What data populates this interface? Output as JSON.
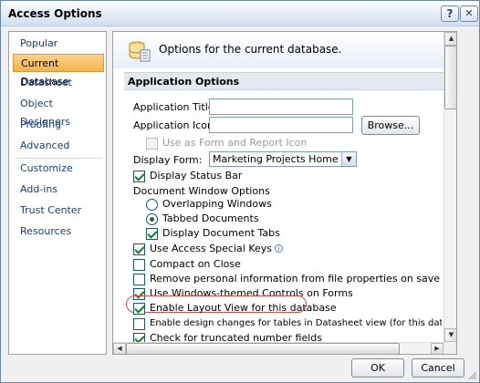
{
  "window": {
    "title": "Access Options"
  },
  "title_buttons": {
    "help": "?",
    "close": "✕"
  },
  "nav": {
    "items": [
      {
        "label": "Popular"
      },
      {
        "label": "Current Database"
      },
      {
        "label": "Datasheet"
      },
      {
        "label": "Object Designers"
      },
      {
        "label": "Proofing"
      },
      {
        "label": "Advanced"
      },
      {
        "label": "Customize"
      },
      {
        "label": "Add-ins"
      },
      {
        "label": "Trust Center"
      },
      {
        "label": "Resources"
      }
    ],
    "selected": "Current Database"
  },
  "content": {
    "header_text": "Options for the current database.",
    "header_icon": "database-options-icon",
    "section_title": "Application Options",
    "app_title": {
      "label": "Application Title:",
      "value": ""
    },
    "app_icon": {
      "label": "Application Icon:",
      "value": "",
      "browse_label": "Browse..."
    },
    "use_as_form_icon": {
      "label": "Use as Form and Report Icon",
      "checked": false,
      "disabled": true
    },
    "display_form": {
      "label": "Display Form:",
      "value": "Marketing Projects Home"
    },
    "display_status_bar": {
      "label": "Display Status Bar",
      "checked": true
    },
    "document_window_options": "Document Window Options",
    "overlapping_windows": {
      "label": "Overlapping Windows",
      "selected": false
    },
    "tabbed_documents": {
      "label": "Tabbed Documents",
      "selected": true
    },
    "display_document_tabs": {
      "label": "Display Document Tabs",
      "checked": true
    },
    "use_access_special_keys": {
      "label": "Use Access Special Keys",
      "checked": true
    },
    "compact_on_close": {
      "label": "Compact on Close",
      "checked": false
    },
    "remove_personal_info": {
      "label": "Remove personal information from file properties on save",
      "checked": false
    },
    "windows_themed_controls": {
      "label": "Use Windows-themed Controls on Forms",
      "checked": true
    },
    "enable_layout_view": {
      "label": "Enable Layout View for this database",
      "checked": true
    },
    "enable_design_changes": {
      "label": "Enable design changes for tables in Datasheet view (for this database)",
      "checked": false
    },
    "check_truncated_fields": {
      "label": "Check for truncated number fields",
      "checked": true
    }
  },
  "footer": {
    "ok_label": "OK",
    "cancel_label": "Cancel"
  }
}
